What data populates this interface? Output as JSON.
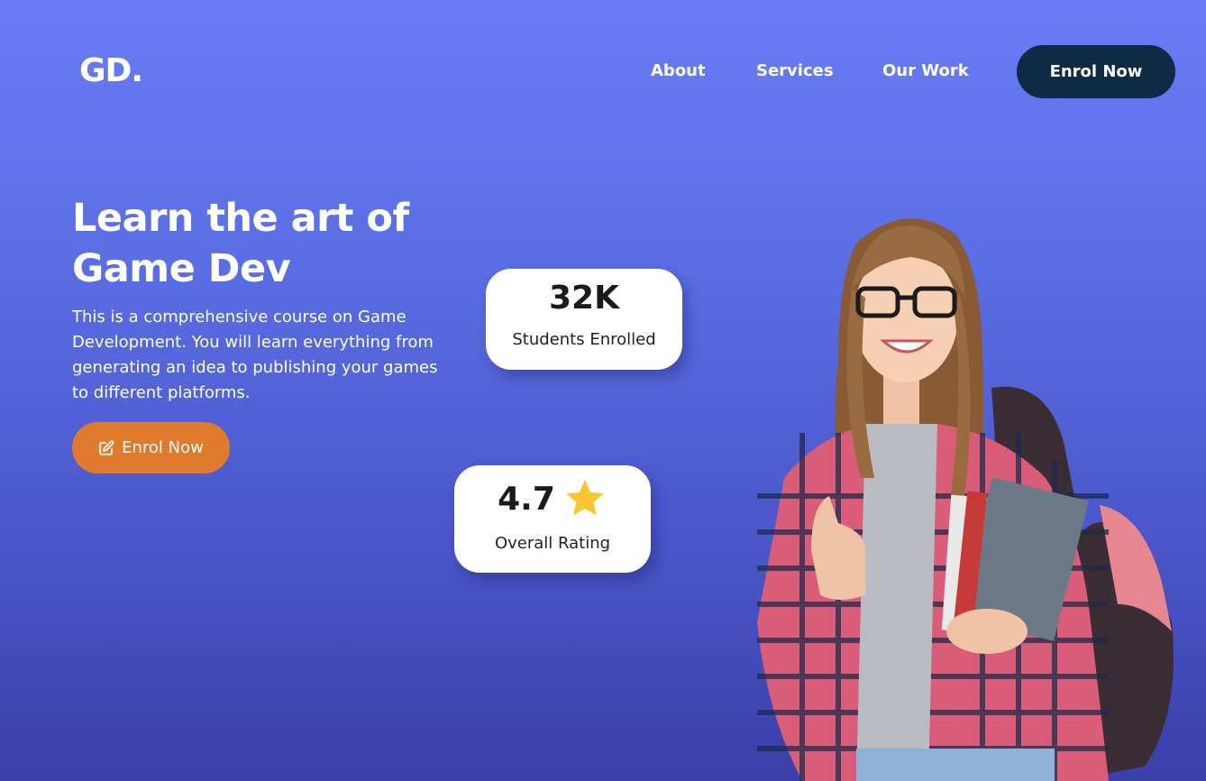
{
  "brand": {
    "logo": "GD."
  },
  "nav": {
    "items": [
      {
        "label": "About"
      },
      {
        "label": "Services"
      },
      {
        "label": "Our Work"
      }
    ],
    "cta_label": "Enrol Now"
  },
  "hero": {
    "title_line1": "Learn the art of",
    "title_line2": "Game Dev",
    "description": "This is a comprehensive course on Game Development. You will learn everything from generating an idea to publishing your games to different platforms.",
    "button_label": "Enrol Now",
    "button_icon": "edit-icon"
  },
  "stats": {
    "students": {
      "value": "32K",
      "label": "Students Enrolled"
    },
    "rating": {
      "value": "4.7",
      "label": "Overall Rating",
      "icon": "star-icon"
    }
  },
  "colors": {
    "background_top": "#6a7cf4",
    "background_bottom": "#3a3fa8",
    "nav_button": "#0e2a44",
    "hero_button": "#e07a2c",
    "star": "#f7c730"
  }
}
